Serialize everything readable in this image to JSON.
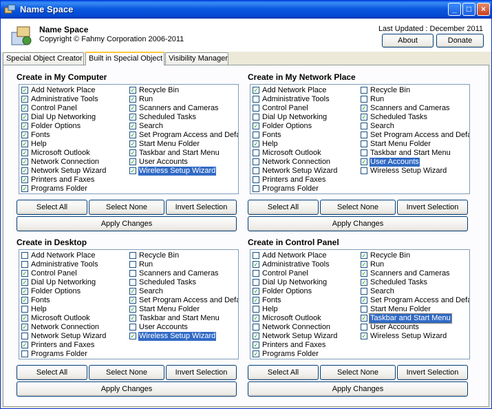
{
  "window": {
    "title": "Name Space",
    "minimize": "_",
    "maximize": "□",
    "close": "×"
  },
  "header": {
    "app_name": "Name Space",
    "copyright": "Copyright © Fahmy Corporation 2006-2011",
    "last_updated": "Last Updated : December 2011",
    "about_label": "About",
    "donate_label": "Donate"
  },
  "tabs": [
    "Special Object Creator",
    "Built in Special Object",
    "Visibility Manager"
  ],
  "active_tab": 1,
  "groups": [
    {
      "title": "Create in My Computer",
      "left": [
        {
          "label": "Add Network Place",
          "checked": true
        },
        {
          "label": "Administrative Tools",
          "checked": true
        },
        {
          "label": "Control Panel",
          "checked": true
        },
        {
          "label": "Dial Up Networking",
          "checked": true
        },
        {
          "label": "Folder Options",
          "checked": true
        },
        {
          "label": "Fonts",
          "checked": true
        },
        {
          "label": "Help",
          "checked": true
        },
        {
          "label": "Microsoft Outlook",
          "checked": true
        },
        {
          "label": "Network Connection",
          "checked": true
        },
        {
          "label": "Network Setup Wizard",
          "checked": true
        },
        {
          "label": "Printers and Faxes",
          "checked": true
        },
        {
          "label": "Programs Folder",
          "checked": true
        }
      ],
      "right": [
        {
          "label": "Recycle Bin",
          "checked": true
        },
        {
          "label": "Run",
          "checked": true
        },
        {
          "label": "Scanners and Cameras",
          "checked": true
        },
        {
          "label": "Scheduled Tasks",
          "checked": true
        },
        {
          "label": "Search",
          "checked": true
        },
        {
          "label": "Set Program Access and Defa",
          "checked": true
        },
        {
          "label": "Start Menu Folder",
          "checked": true
        },
        {
          "label": "Taskbar and Start Menu",
          "checked": true
        },
        {
          "label": "User Accounts",
          "checked": true
        },
        {
          "label": "Wireless Setup Wizard",
          "checked": true,
          "selected": true
        }
      ],
      "select_all": "Select All",
      "select_none": "Select None",
      "invert": "Invert Selection",
      "apply": "Apply Changes"
    },
    {
      "title": "Create in My Network Place",
      "left": [
        {
          "label": "Add Network Place",
          "checked": true
        },
        {
          "label": "Administrative Tools",
          "checked": false
        },
        {
          "label": "Control Panel",
          "checked": false
        },
        {
          "label": "Dial Up Networking",
          "checked": false
        },
        {
          "label": "Folder Options",
          "checked": true
        },
        {
          "label": "Fonts",
          "checked": false
        },
        {
          "label": "Help",
          "checked": true
        },
        {
          "label": "Microsoft Outlook",
          "checked": false
        },
        {
          "label": "Network Connection",
          "checked": false
        },
        {
          "label": "Network Setup Wizard",
          "checked": false
        },
        {
          "label": "Printers and Faxes",
          "checked": false
        },
        {
          "label": "Programs Folder",
          "checked": false
        }
      ],
      "right": [
        {
          "label": "Recycle Bin",
          "checked": false
        },
        {
          "label": "Run",
          "checked": false
        },
        {
          "label": "Scanners and Cameras",
          "checked": true
        },
        {
          "label": "Scheduled Tasks",
          "checked": true
        },
        {
          "label": "Search",
          "checked": false
        },
        {
          "label": "Set Program Access and Defau",
          "checked": false
        },
        {
          "label": "Start Menu Folder",
          "checked": false
        },
        {
          "label": "Taskbar and Start Menu",
          "checked": false
        },
        {
          "label": "User Accounts",
          "checked": true,
          "selected": true
        },
        {
          "label": "Wireless Setup Wizard",
          "checked": false
        }
      ],
      "select_all": "Select All",
      "select_none": "Select None",
      "invert": "Invert Selection",
      "apply": "Apply Changes"
    },
    {
      "title": "Create in Desktop",
      "left": [
        {
          "label": "Add Network Place",
          "checked": false
        },
        {
          "label": "Administrative Tools",
          "checked": false
        },
        {
          "label": "Control Panel",
          "checked": true
        },
        {
          "label": "Dial Up Networking",
          "checked": true
        },
        {
          "label": "Folder Options",
          "checked": true
        },
        {
          "label": "Fonts",
          "checked": true
        },
        {
          "label": "Help",
          "checked": false
        },
        {
          "label": "Microsoft Outlook",
          "checked": true
        },
        {
          "label": "Network Connection",
          "checked": true
        },
        {
          "label": "Network Setup Wizard",
          "checked": false
        },
        {
          "label": "Printers and Faxes",
          "checked": true
        },
        {
          "label": "Programs Folder",
          "checked": false
        }
      ],
      "right": [
        {
          "label": "Recycle Bin",
          "checked": false
        },
        {
          "label": "Run",
          "checked": false
        },
        {
          "label": "Scanners and Cameras",
          "checked": false
        },
        {
          "label": "Scheduled Tasks",
          "checked": false
        },
        {
          "label": "Search",
          "checked": true
        },
        {
          "label": "Set Program Access and Defa",
          "checked": true
        },
        {
          "label": "Start Menu Folder",
          "checked": true
        },
        {
          "label": "Taskbar and Start Menu",
          "checked": true
        },
        {
          "label": "User Accounts",
          "checked": false
        },
        {
          "label": "Wireless Setup Wizard",
          "checked": true,
          "selected": true
        }
      ],
      "select_all": "Select All",
      "select_none": "Select None",
      "invert": "Invert Selection",
      "apply": "Apply Changes"
    },
    {
      "title": "Create in Control Panel",
      "left": [
        {
          "label": "Add Network Place",
          "checked": false
        },
        {
          "label": "Administrative Tools",
          "checked": true
        },
        {
          "label": "Control Panel",
          "checked": false
        },
        {
          "label": "Dial Up Networking",
          "checked": false
        },
        {
          "label": "Folder Options",
          "checked": true
        },
        {
          "label": "Fonts",
          "checked": true
        },
        {
          "label": "Help",
          "checked": false
        },
        {
          "label": "Microsoft Outlook",
          "checked": true
        },
        {
          "label": "Network Connection",
          "checked": false
        },
        {
          "label": "Network Setup Wizard",
          "checked": true
        },
        {
          "label": "Printers and Faxes",
          "checked": true
        },
        {
          "label": "Programs Folder",
          "checked": true
        }
      ],
      "right": [
        {
          "label": "Recycle Bin",
          "checked": true
        },
        {
          "label": "Run",
          "checked": true
        },
        {
          "label": "Scanners and Cameras",
          "checked": true
        },
        {
          "label": "Scheduled Tasks",
          "checked": true
        },
        {
          "label": "Search",
          "checked": false
        },
        {
          "label": "Set Program Access and Defau",
          "checked": true
        },
        {
          "label": "Start Menu Folder",
          "checked": false
        },
        {
          "label": "Taskbar and Start Menu",
          "checked": true,
          "selected": true,
          "focused": true
        },
        {
          "label": "User Accounts",
          "checked": false
        },
        {
          "label": "Wireless Setup Wizard",
          "checked": true
        }
      ],
      "select_all": "Select All",
      "select_none": "Select None",
      "invert": "Invert Selection",
      "apply": "Apply Changes"
    }
  ]
}
